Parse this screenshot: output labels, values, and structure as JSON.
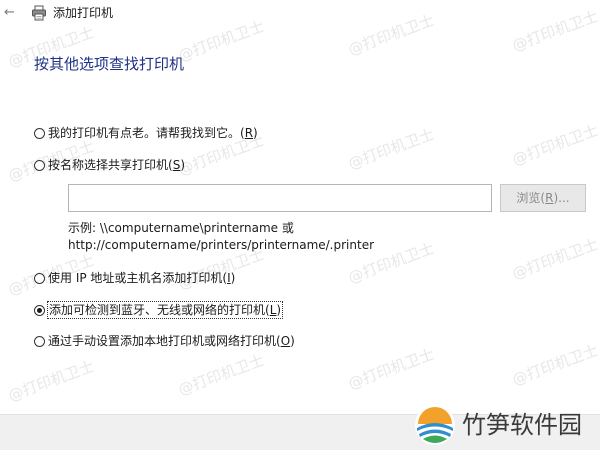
{
  "window": {
    "title": "添加打印机",
    "heading": "按其他选项查找打印机"
  },
  "options": [
    {
      "label": "我的打印机有点老。请帮我找到它。",
      "key": "R",
      "checked": false
    },
    {
      "label": "按名称选择共享打印机",
      "key": "S",
      "checked": false
    },
    {
      "label": "使用 IP 地址或主机名添加打印机",
      "key": "I",
      "checked": false
    },
    {
      "label": "添加可检测到蓝牙、无线或网络的打印机",
      "key": "L",
      "checked": true
    },
    {
      "label": "通过手动设置添加本地打印机或网络打印机",
      "key": "O",
      "checked": false
    }
  ],
  "share": {
    "input_value": "",
    "browse_label": "浏览",
    "browse_key": "R",
    "browse_suffix": "...",
    "example_line1": "示例: \\\\computername\\printername 或",
    "example_line2": "http://computername/printers/printername/.printer"
  },
  "watermark": {
    "text": "@打印机卫士"
  },
  "brand": {
    "name": "竹笋软件园",
    "colors": {
      "sun": "#f2a12a",
      "leaf": "#2f8fd0",
      "green": "#3fa85a"
    }
  }
}
